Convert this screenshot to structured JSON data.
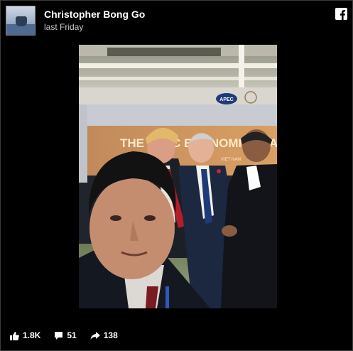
{
  "post": {
    "author": "Christopher Bong Go",
    "timestamp": "last Friday"
  },
  "photo": {
    "banner_text": "THE   APEC ECONOMIC LEA",
    "banner_sub": "VIET NAM",
    "logo_text": "APEC"
  },
  "stats": {
    "likes": "1.8K",
    "comments": "51",
    "shares": "138"
  },
  "icons": {
    "brand": "facebook-icon",
    "like": "thumbs-up-icon",
    "comment": "comment-icon",
    "share": "share-arrow-icon"
  },
  "colors": {
    "background": "#000000",
    "banner": "#c9915a"
  }
}
